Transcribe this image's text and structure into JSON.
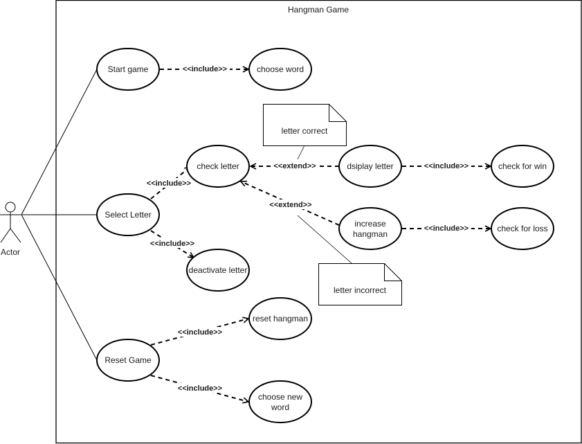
{
  "system": {
    "title": "Hangman Game"
  },
  "actor": {
    "label": "Actor"
  },
  "use_cases": {
    "start_game": "Start game",
    "choose_word": "choose word",
    "check_letter": "check letter",
    "display_letter": "dsiplay letter",
    "check_for_win": "check for win",
    "select_letter": "Select Letter",
    "increase_hangman_1": "increase",
    "increase_hangman_2": "hangman",
    "check_for_loss": "check for loss",
    "deactivate_letter": "deactivate letter",
    "reset_hangman": "reset hangman",
    "reset_game": "Reset Game",
    "choose_new_word_1": "choose new",
    "choose_new_word_2": "word"
  },
  "notes": {
    "letter_correct": "letter correct",
    "letter_incorrect": "letter incorrect"
  },
  "relations": {
    "include": "<<include>>",
    "extend": "<<extend>>"
  }
}
